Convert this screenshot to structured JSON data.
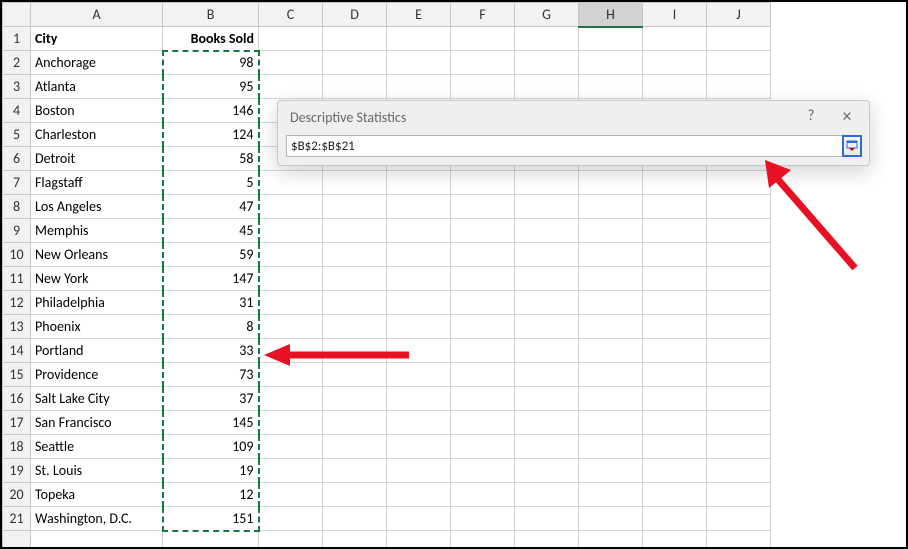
{
  "columns": [
    "A",
    "B",
    "C",
    "D",
    "E",
    "F",
    "G",
    "H",
    "I",
    "J"
  ],
  "selected_column": "H",
  "headers": {
    "A": "City",
    "B": "Books Sold"
  },
  "rows": [
    {
      "city": "Anchorage",
      "books": 98
    },
    {
      "city": "Atlanta",
      "books": 95
    },
    {
      "city": "Boston",
      "books": 146
    },
    {
      "city": "Charleston",
      "books": 124
    },
    {
      "city": "Detroit",
      "books": 58
    },
    {
      "city": "Flagstaff",
      "books": 5
    },
    {
      "city": "Los Angeles",
      "books": 47
    },
    {
      "city": "Memphis",
      "books": 45
    },
    {
      "city": "New Orleans",
      "books": 59
    },
    {
      "city": "New York",
      "books": 147
    },
    {
      "city": "Philadelphia",
      "books": 31
    },
    {
      "city": "Phoenix",
      "books": 8
    },
    {
      "city": "Portland",
      "books": 33
    },
    {
      "city": "Providence",
      "books": 73
    },
    {
      "city": "Salt Lake City",
      "books": 37
    },
    {
      "city": "San Francisco",
      "books": 145
    },
    {
      "city": "Seattle",
      "books": 109
    },
    {
      "city": "St. Louis",
      "books": 19
    },
    {
      "city": "Topeka",
      "books": 12
    },
    {
      "city": "Washington, D.C.",
      "books": 151
    }
  ],
  "selection_range": "B2:B21",
  "dialog": {
    "title": "Descriptive Statistics",
    "help": "?",
    "close": "×",
    "input_value": "$B$2:$B$21"
  }
}
